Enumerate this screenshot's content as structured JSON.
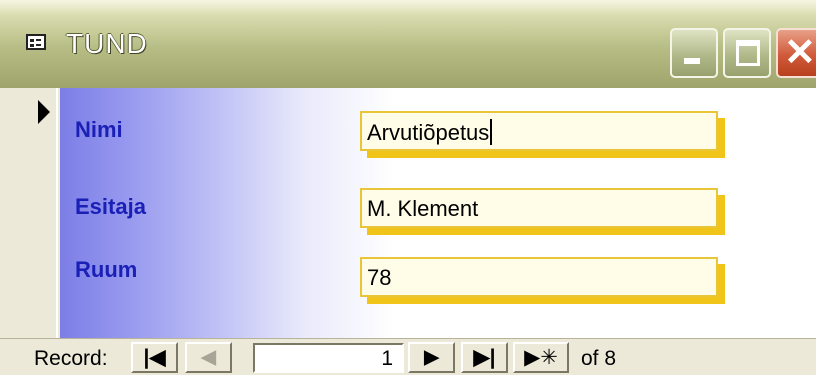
{
  "window": {
    "title": "TUND"
  },
  "form": {
    "fields": [
      {
        "label": "Nimi",
        "value": "Arvutiõpetus"
      },
      {
        "label": "Esitaja",
        "value": "M. Klement"
      },
      {
        "label": "Ruum",
        "value": "78"
      }
    ]
  },
  "navigation": {
    "record_label": "Record:",
    "current_record": "1",
    "total_text": "of 8",
    "buttons": {
      "first": "|◀",
      "prev": "◀",
      "next": "▶",
      "last": "▶|",
      "new": "▶✳"
    }
  },
  "colors": {
    "label_text": "#1a1fb6",
    "field_border": "#e9c53a",
    "field_shadow": "#f0c419",
    "close_button": "#d05a3a"
  }
}
